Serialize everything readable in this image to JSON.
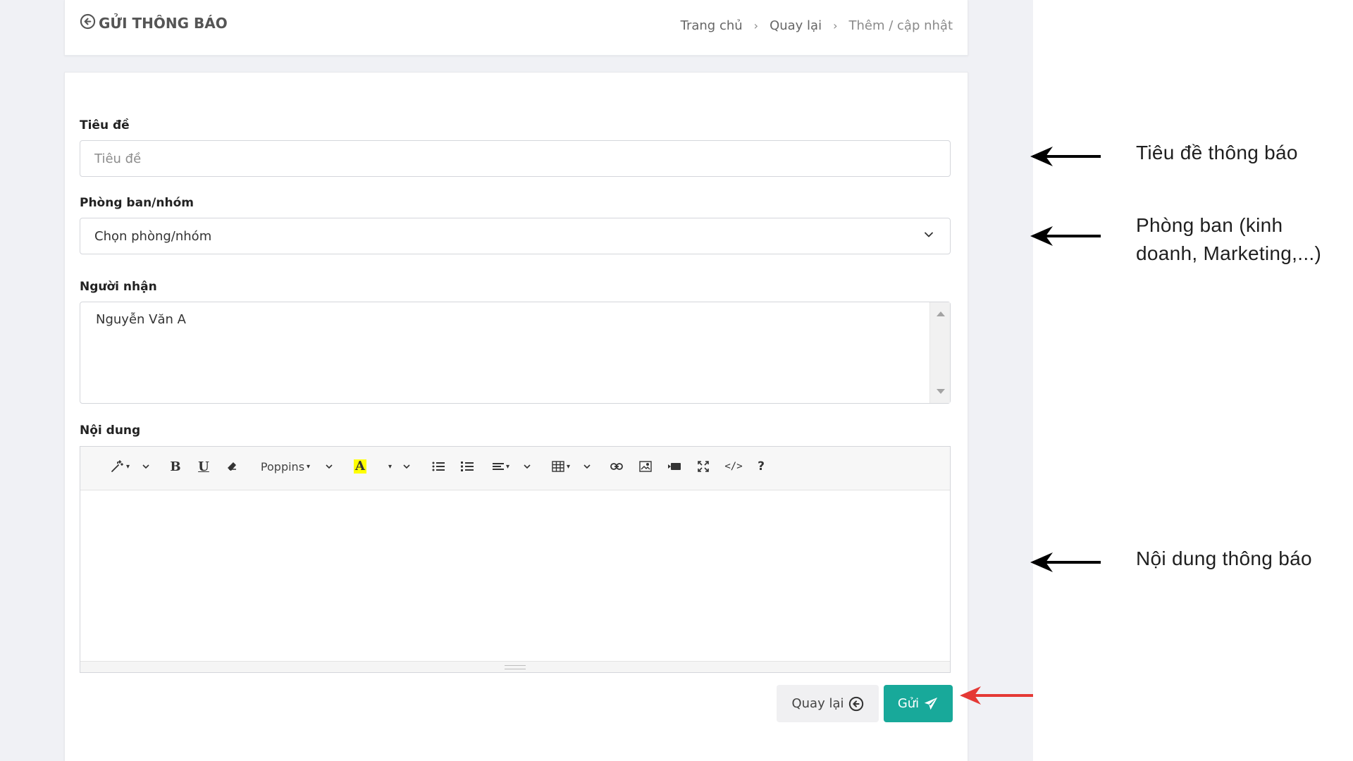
{
  "header": {
    "title": "GỬI THÔNG BÁO",
    "breadcrumb": [
      "Trang chủ",
      "Quay lại",
      "Thêm / cập nhật"
    ]
  },
  "form": {
    "title_label": "Tiêu đề",
    "title_placeholder": "Tiêu đề",
    "department_label": "Phòng ban/nhóm",
    "department_value": "Chọn phòng/nhóm",
    "recipient_label": "Người nhận",
    "recipient_value": "Nguyễn Văn A",
    "content_label": "Nội dung",
    "toolbar": {
      "font_name": "Poppins",
      "buttons": [
        "magic-style",
        "bold",
        "underline",
        "eraser",
        "font-name",
        "text-color",
        "unordered-list",
        "ordered-list",
        "paragraph-align",
        "table",
        "link",
        "picture",
        "video",
        "fullscreen",
        "code-view",
        "help"
      ]
    },
    "back_button": "Quay lại",
    "send_button": "Gửi"
  },
  "annotations": [
    {
      "text": "Tiêu đề thông báo",
      "arrow_color": "#000000"
    },
    {
      "text": "Phòng ban (kinh doanh, Marketing,...)",
      "arrow_color": "#000000"
    },
    {
      "text": "Nội dung thông báo",
      "arrow_color": "#000000"
    },
    {
      "text": "",
      "arrow_color": "#e53935"
    }
  ],
  "colors": {
    "primary": "#18a99a",
    "background": "#f0f1f5",
    "annotation_red": "#e53935"
  }
}
